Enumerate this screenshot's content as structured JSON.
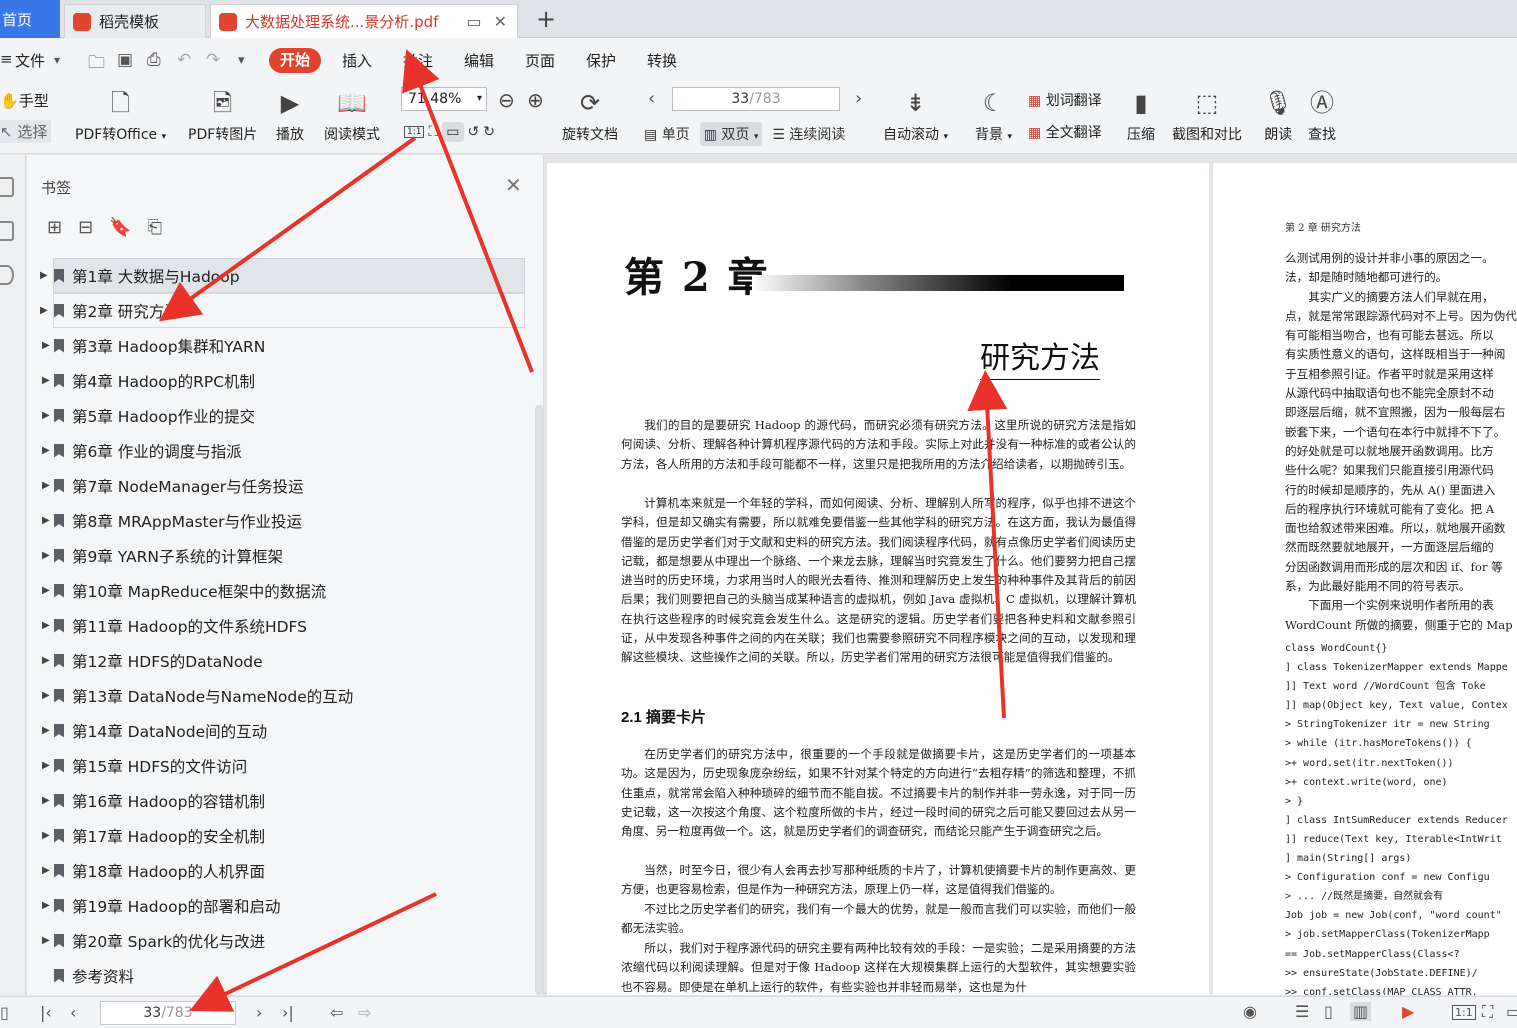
{
  "tabs": {
    "home": "首页",
    "template": "稻壳模板",
    "document": "大数据处理系统...景分析.pdf",
    "new_tab": "+"
  },
  "menu": {
    "file": "文件",
    "start": "开始",
    "insert": "插入",
    "annotate": "批注",
    "edit": "编辑",
    "page": "页面",
    "protect": "保护",
    "convert": "转换"
  },
  "toolbar": {
    "hand": "手型",
    "select": "选择",
    "pdf_to_office": "PDF转Office",
    "pdf_to_image": "PDF转图片",
    "play": "播放",
    "read_mode": "阅读模式",
    "zoom": "71.48%",
    "rotate": "旋转文档",
    "page_current": "33",
    "page_total": "/783",
    "single_page": "单页",
    "double_page": "双页",
    "continuous": "连续阅读",
    "auto_scroll": "自动滚动",
    "background": "背景",
    "word_translate": "划词翻译",
    "full_translate": "全文翻译",
    "compress": "压缩",
    "screenshot_compare": "截图和对比",
    "read_aloud": "朗读",
    "find": "查找",
    "ratio": "1:1"
  },
  "bookmarks": {
    "title": "书签",
    "items": [
      {
        "label": "第1章  大数据与Hadoop",
        "arrow": true
      },
      {
        "label": "第2章  研究方法",
        "arrow": true
      },
      {
        "label": "第3章  Hadoop集群和YARN",
        "arrow": true
      },
      {
        "label": "第4章  Hadoop的RPC机制",
        "arrow": true
      },
      {
        "label": "第5章  Hadoop作业的提交",
        "arrow": true
      },
      {
        "label": "第6章  作业的调度与指派",
        "arrow": true
      },
      {
        "label": "第7章  NodeManager与任务投运",
        "arrow": true
      },
      {
        "label": "第8章  MRAppMaster与作业投运",
        "arrow": true
      },
      {
        "label": "第9章  YARN子系统的计算框架",
        "arrow": true
      },
      {
        "label": "第10章  MapReduce框架中的数据流",
        "arrow": true
      },
      {
        "label": "第11章  Hadoop的文件系统HDFS",
        "arrow": true
      },
      {
        "label": "第12章  HDFS的DataNode",
        "arrow": true
      },
      {
        "label": "第13章  DataNode与NameNode的互动",
        "arrow": true
      },
      {
        "label": "第14章  DataNode间的互动",
        "arrow": true
      },
      {
        "label": "第15章  HDFS的文件访问",
        "arrow": true
      },
      {
        "label": "第16章  Hadoop的容错机制",
        "arrow": true
      },
      {
        "label": "第17章  Hadoop的安全机制",
        "arrow": true
      },
      {
        "label": "第18章  Hadoop的人机界面",
        "arrow": true
      },
      {
        "label": "第19章  Hadoop的部署和启动",
        "arrow": true
      },
      {
        "label": "第20章  Spark的优化与改进",
        "arrow": true
      },
      {
        "label": "参考资料",
        "arrow": false
      }
    ]
  },
  "page_left": {
    "chapter": "第 2 章",
    "title": "研究方法",
    "p1": "我们的目的是要研究 Hadoop 的源代码，而研究必须有研究方法。这里所说的研究方法是指如何阅读、分析、理解各种计算机程序源代码的方法和手段。实际上对此并没有一种标准的或者公认的方法，各人所用的方法和手段可能都不一样，这里只是把我所用的方法介绍给读者，以期抛砖引玉。",
    "p2": "计算机本来就是一个年轻的学科，而如何阅读、分析、理解别人所写的程序，似乎也排不进这个学科，但是却又确实有需要，所以就难免要借鉴一些其他学科的研究方法。在这方面，我认为最值得借鉴的是历史学者们对于文献和史料的研究方法。我们阅读程序代码，就有点像历史学者们阅读历史记载，都是想要从中理出一个脉络、一个来龙去脉，理解当时究竟发生了什么。他们要努力把自己摆进当时的历史环境，力求用当时人的眼光去看待、推测和理解历史上发生的种种事件及其背后的前因后果；我们则要把自己的头脑当成某种语言的虚拟机，例如 Java 虚拟机、C 虚拟机，以理解计算机在执行这些程序的时候究竟会发生什么。这是研究的逻辑。历史学者们要把各种史料和文献参照引证，从中发现各种事件之间的内在关联；我们也需要参照研究不同程序模块之间的互动，以发现和理解这些模块、这些操作之间的关联。所以，历史学者们常用的研究方法很可能是值得我们借鉴的。",
    "section": "2.1   摘要卡片",
    "p3": "在历史学者们的研究方法中，很重要的一个手段就是做摘要卡片，这是历史学者们的一项基本功。这是因为，历史现象庞杂纷纭，如果不针对某个特定的方向进行“去粗存精”的筛选和整理，不抓住重点，就常常会陷入种种琐碎的细节而不能自拔。不过摘要卡片的制作并非一劳永逸，对于同一历史记载，这一次按这个角度、这个粒度所做的卡片，经过一段时间的研究之后可能又要回过去从另一角度、另一粒度再做一个。这，就是历史学者们的调查研究，而结论只能产生于调查研究之后。",
    "p4": "当然，时至今日，很少有人会再去抄写那种纸质的卡片了，计算机使摘要卡片的制作更高效、更方便，也更容易检索，但是作为一种研究方法，原理上仍一样，这是值得我们借鉴的。",
    "p5": "不过比之历史学者们的研究，我们有一个最大的优势，就是一般而言我们可以实验，而他们一般都无法实验。",
    "p6": "所以，我们对于程序源代码的研究主要有两种比较有效的手段：一是实验；二是采用摘要的方法浓缩代码以利阅读理解。但是对于像 Hadoop 这样在大规模集群上运行的大型软件，其实想要实验也不容易。即使是在单机上运行的软件，有些实验也并非轻而易举，这也是为什"
  },
  "page_right": {
    "header": "第 2 章   研究方法",
    "lines": [
      "么测试用例的设计并非小事的原因之一。",
      "法，却是随时随地都可进行的。",
      "　　其实广义的摘要方法人们早就在用，",
      "点，就是常常跟踪源代码对不上号。因为伪代",
      "有可能相当吻合，也有可能去甚远。所以",
      "有实质性意义的语句，这样既相当于一种阅",
      "于互相参照引证。作者平时就是采用这样",
      "从源代码中抽取语句也不能完全原封不动",
      "即逐层后缩，就不宜照搬，因为一般每层右",
      "嵌套下来，一个语句在本行中就排不下了。",
      "的好处就是可以就地展开函数调用。比方",
      "些什么呢？如果我们只能直接引用源代码",
      "行的时候却是顺序的，先从 A() 里面进入",
      "后的程序执行环境就可能有了变化。把 A",
      "面也给叙述带来困难。所以，就地展开函数",
      "然而既然要就地展开，一方面逐层后缩的",
      "分因函数调用而形成的层次和因 if、for 等",
      "系，为此最好能用不同的符号表示。",
      "　　下面用一个实例来说明作者所用的表",
      "WordCount 所做的摘要，侧重于它的 Map"
    ],
    "code": [
      "class WordCount{}",
      "] class TokenizerMapper extends Mappe",
      "]] Text word     //WordCount 包含 Toke",
      "]] map(Object key, Text value, Contex",
      "  > StringTokenizer itr = new String",
      "  > while (itr.hasMoreTokens()) {",
      "  >+ word.set(itr.nextToken())",
      "  >+ context.write(word, one)",
      "  > }",
      "] class IntSumReducer extends Reducer",
      "]] reduce(Text key, Iterable<IntWrit",
      "] main(String[] args)",
      "  > Configuration conf = new Configu",
      "  > ...    //既然是摘要，自然就会有",
      "  Job job = new Job(conf, \"word count\"",
      "  > job.setMapperClass(TokenizerMapp",
      "    == Job.setMapperClass(Class<?",
      "  >> ensureState(JobState.DEFINE)/",
      "  >> conf.setClass(MAP_CLASS_ATTR,"
    ]
  },
  "statusbar": {
    "page_current": "33",
    "page_total": "/783"
  },
  "colors": {
    "accent_red": "#e2442f",
    "arrow_red": "#e8322a",
    "home_blue": "#3b78e7"
  }
}
